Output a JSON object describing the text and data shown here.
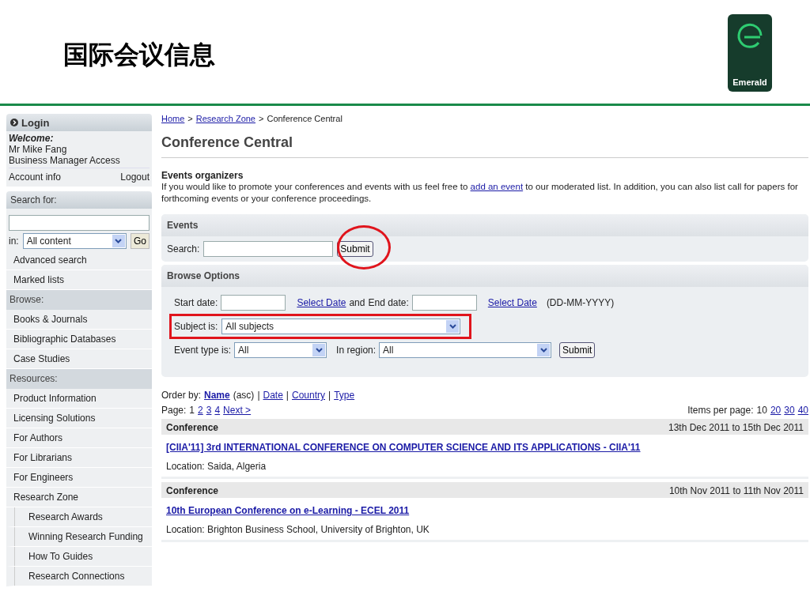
{
  "slide": {
    "title": "国际会议信息",
    "logo_text": "Emerald"
  },
  "sidebar": {
    "login": {
      "title": "Login",
      "welcome": "Welcome:",
      "name": "Mr Mike Fang",
      "access": "Business Manager Access",
      "account_link": "Account info",
      "logout_link": "Logout"
    },
    "search": {
      "header": "Search for:",
      "in_label": "in:",
      "scope": "All content",
      "go_button": "Go"
    },
    "items": [
      {
        "kind": "link",
        "label": "Advanced search"
      },
      {
        "kind": "link",
        "label": "Marked lists"
      },
      {
        "kind": "header",
        "label": "Browse:"
      },
      {
        "kind": "link",
        "label": "Books & Journals"
      },
      {
        "kind": "link",
        "label": "Bibliographic Databases"
      },
      {
        "kind": "link",
        "label": "Case Studies"
      },
      {
        "kind": "header",
        "label": "Resources:"
      },
      {
        "kind": "link",
        "label": "Product Information"
      },
      {
        "kind": "link",
        "label": "Licensing Solutions"
      },
      {
        "kind": "link",
        "label": "For Authors"
      },
      {
        "kind": "link",
        "label": "For Librarians"
      },
      {
        "kind": "link",
        "label": "For Engineers"
      },
      {
        "kind": "link",
        "label": "Research Zone"
      },
      {
        "kind": "sublink",
        "label": "Research Awards"
      },
      {
        "kind": "sublink",
        "label": "Winning Research Funding"
      },
      {
        "kind": "sublink",
        "label": "How To Guides"
      },
      {
        "kind": "sublink",
        "label": "Research Connections"
      }
    ]
  },
  "breadcrumb": {
    "separator": ">",
    "items": [
      {
        "label": "Home",
        "link": true
      },
      {
        "label": "Research Zone",
        "link": true
      },
      {
        "label": "Conference Central",
        "link": false
      }
    ]
  },
  "page_title": "Conference Central",
  "intro": {
    "heading": "Events organizers",
    "text_before": "If you would like to promote your conferences and events with us feel free to",
    "link": "add an event",
    "text_after": "to our moderated list. In addition, you can also list call for papers for forthcoming events or your conference proceedings."
  },
  "events_panel": {
    "title": "Events",
    "search_label": "Search:",
    "submit": "Submit"
  },
  "browse_panel": {
    "title": "Browse Options",
    "start_label": "Start date:",
    "select_date_1": "Select Date",
    "and": "and",
    "end_label": "End date:",
    "select_date_2": "Select Date",
    "format_hint": "(DD-MM-YYYY)",
    "subject_label": "Subject is:",
    "subject_value": "All subjects",
    "type_label": "Event type is:",
    "type_value": "All",
    "region_label": "In region:",
    "region_value": "All",
    "submit": "Submit"
  },
  "order": {
    "label": "Order by:",
    "direction": "(asc)",
    "separator": "|",
    "options": [
      {
        "label": "Name",
        "selected": true
      },
      {
        "label": "Date",
        "selected": false
      },
      {
        "label": "Country",
        "selected": false
      },
      {
        "label": "Type",
        "selected": false
      }
    ]
  },
  "pagination": {
    "label": "Page:",
    "pages": [
      {
        "label": "1",
        "selected": true
      },
      {
        "label": "2",
        "selected": false
      },
      {
        "label": "3",
        "selected": false
      },
      {
        "label": "4",
        "selected": false
      }
    ],
    "next": "Next >",
    "per_page_label": "Items per page:",
    "per_page": [
      {
        "label": "10",
        "selected": true
      },
      {
        "label": "20",
        "selected": false
      },
      {
        "label": "30",
        "selected": false
      },
      {
        "label": "40",
        "selected": false
      }
    ]
  },
  "events": [
    {
      "type": "Conference",
      "dates": "13th Dec 2011 to 15th Dec 2011",
      "title": "[CIIA'11] 3rd INTERNATIONAL CONFERENCE ON COMPUTER SCIENCE AND ITS APPLICATIONS - CIIA'11",
      "location": "Location: Saida, Algeria"
    },
    {
      "type": "Conference",
      "dates": "10th Nov 2011 to 11th Nov 2011",
      "title": "10th European Conference on e-Learning - ECEL 2011",
      "location": "Location: Brighton Business School, University of Brighton, UK"
    }
  ]
}
